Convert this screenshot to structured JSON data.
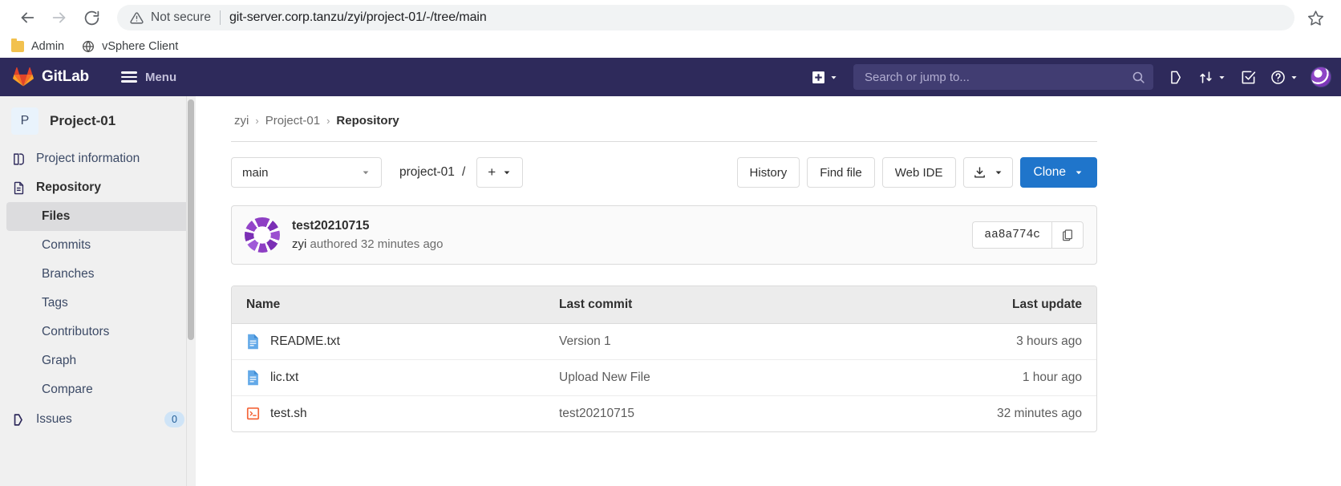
{
  "browser": {
    "back_icon": "back-arrow-icon",
    "forward_icon": "forward-arrow-icon",
    "reload_icon": "reload-icon",
    "security_label": "Not secure",
    "url": "git-server.corp.tanzu/zyi/project-01/-/tree/main",
    "star_icon": "bookmark-star-icon",
    "bookmarks": [
      {
        "label": "Admin",
        "icon": "folder-icon"
      },
      {
        "label": "vSphere Client",
        "icon": "globe-icon"
      }
    ]
  },
  "navbar": {
    "brand": "GitLab",
    "logo_icon": "gitlab-tanuki-icon",
    "menu_label": "Menu",
    "hamburger_icon": "hamburger-menu-icon",
    "new_icon": "plus-square-icon",
    "new_chevron_icon": "chevron-down-icon",
    "search_placeholder": "Search or jump to...",
    "search_value": "",
    "search_icon": "magnifier-icon",
    "issues_icon": "issues-icon",
    "merge_requests_icon": "merge-request-icon",
    "merge_chevron_icon": "chevron-down-icon",
    "todos_icon": "todo-checkbox-icon",
    "help_icon": "question-circle-icon",
    "help_chevron_icon": "chevron-down-icon",
    "avatar": "user-avatar",
    "background_color": "#2e2a5b"
  },
  "sidebar": {
    "project_initial": "P",
    "project_name": "Project-01",
    "items": [
      {
        "label": "Project information",
        "icon": "project-info-icon",
        "type": "top"
      },
      {
        "label": "Repository",
        "icon": "repository-book-icon",
        "type": "top"
      },
      {
        "label": "Files",
        "type": "sub",
        "active": true
      },
      {
        "label": "Commits",
        "type": "sub"
      },
      {
        "label": "Branches",
        "type": "sub"
      },
      {
        "label": "Tags",
        "type": "sub"
      },
      {
        "label": "Contributors",
        "type": "sub"
      },
      {
        "label": "Graph",
        "type": "sub"
      },
      {
        "label": "Compare",
        "type": "sub"
      },
      {
        "label": "Issues",
        "icon": "issues-icon",
        "type": "top",
        "badge": "0"
      }
    ]
  },
  "breadcrumb": {
    "group": "zyi",
    "project": "Project-01",
    "current": "Repository",
    "separator": "›"
  },
  "toolbar": {
    "branch": "main",
    "branch_chevron_icon": "chevron-down-icon",
    "path_root": "project-01",
    "path_separator": "/",
    "add_label": "+",
    "add_chevron_icon": "chevron-down-icon",
    "history_label": "History",
    "find_file_label": "Find file",
    "web_ide_label": "Web IDE",
    "download_icon": "download-icon",
    "download_chevron_icon": "chevron-down-icon",
    "clone_label": "Clone",
    "clone_chevron_icon": "chevron-down-icon",
    "clone_color": "#1f75cb"
  },
  "commit": {
    "avatar": "commit-author-avatar",
    "title": "test20210715",
    "author": "zyi",
    "meta_suffix": "authored 32 minutes ago",
    "sha": "aa8a774c",
    "copy_icon": "copy-to-clipboard-icon"
  },
  "files": {
    "columns": [
      "Name",
      "Last commit",
      "Last update"
    ],
    "rows": [
      {
        "name": "README.txt",
        "icon": "text-file-icon",
        "commit": "Version 1",
        "update": "3 hours ago"
      },
      {
        "name": "lic.txt",
        "icon": "text-file-icon",
        "commit": "Upload New File",
        "update": "1 hour ago"
      },
      {
        "name": "test.sh",
        "icon": "shell-script-icon",
        "commit": "test20210715",
        "update": "32 minutes ago"
      }
    ]
  }
}
